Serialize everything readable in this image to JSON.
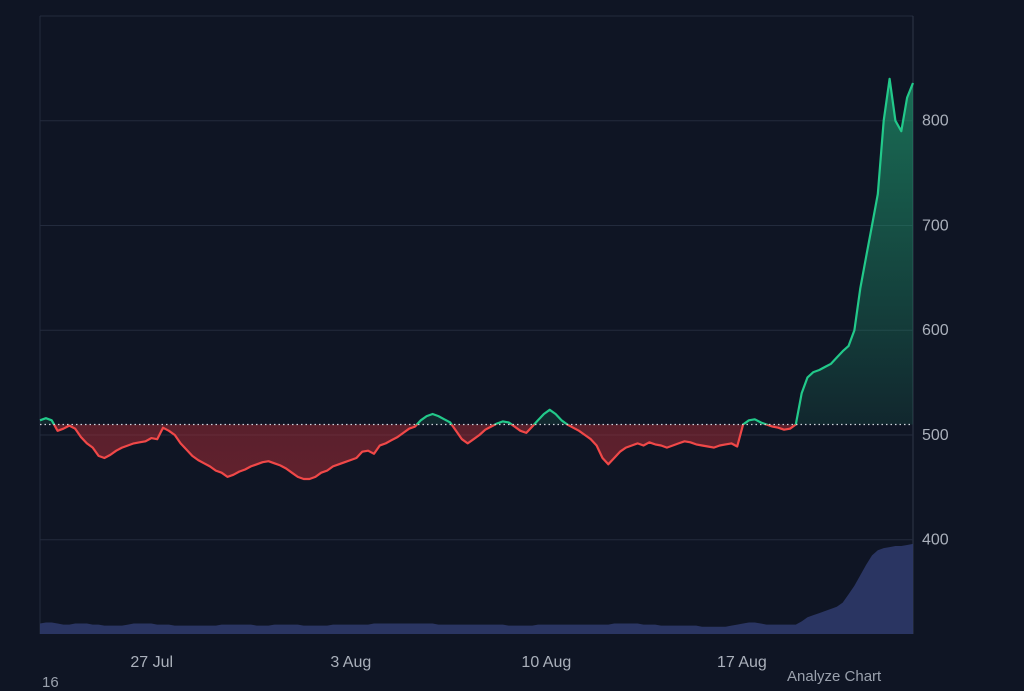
{
  "chart_data": {
    "type": "area",
    "title": "",
    "xlabel": "",
    "ylabel": "",
    "x_ticks": [
      "27 Jul",
      "3 Aug",
      "10 Aug",
      "17 Aug"
    ],
    "y_ticks": [
      400,
      500,
      600,
      700,
      800
    ],
    "ylim": [
      310,
      900
    ],
    "baseline": 510,
    "grid": true,
    "colors": {
      "above": "#22c98a",
      "below": "#f04848",
      "volume": "#2c3766",
      "grid": "#232b3d",
      "background": "#0f1524",
      "baseline": "#d0d4dc"
    },
    "series": [
      {
        "values": [
          514,
          516,
          514,
          504,
          506,
          509,
          506,
          498,
          492,
          488,
          480,
          478,
          481,
          485,
          488,
          490,
          492,
          493,
          494,
          497,
          496,
          507,
          504,
          500,
          492,
          486,
          480,
          476,
          473,
          470,
          466,
          464,
          460,
          462,
          465,
          467,
          470,
          472,
          474,
          475,
          473,
          471,
          468,
          464,
          460,
          458,
          458,
          460,
          464,
          466,
          470,
          472,
          474,
          476,
          478,
          484,
          485,
          482,
          490,
          492,
          495,
          498,
          502,
          506,
          508,
          514,
          518,
          520,
          518,
          515,
          512,
          504,
          496,
          492,
          496,
          500,
          505,
          508,
          511,
          513,
          512,
          508,
          504,
          502,
          508,
          514,
          520,
          524,
          520,
          514,
          510,
          507,
          504,
          500,
          496,
          490,
          478,
          472,
          478,
          484,
          488,
          490,
          492,
          490,
          493,
          491,
          490,
          488,
          490,
          492,
          494,
          493,
          491,
          490,
          489,
          488,
          490,
          491,
          492,
          489,
          510,
          514,
          515,
          512,
          510,
          508,
          507,
          505,
          506,
          510,
          540,
          555,
          560,
          562,
          565,
          568,
          574,
          580,
          585,
          600,
          640,
          670,
          700,
          730,
          800,
          840,
          800,
          790,
          822,
          836
        ],
        "volume": [
          320,
          321,
          321,
          320,
          319,
          319,
          320,
          320,
          320,
          319,
          319,
          318,
          318,
          318,
          318,
          319,
          320,
          320,
          320,
          320,
          319,
          319,
          319,
          318,
          318,
          318,
          318,
          318,
          318,
          318,
          318,
          319,
          319,
          319,
          319,
          319,
          319,
          318,
          318,
          318,
          319,
          319,
          319,
          319,
          319,
          318,
          318,
          318,
          318,
          318,
          319,
          319,
          319,
          319,
          319,
          319,
          319,
          320,
          320,
          320,
          320,
          320,
          320,
          320,
          320,
          320,
          320,
          320,
          319,
          319,
          319,
          319,
          319,
          319,
          319,
          319,
          319,
          319,
          319,
          319,
          318,
          318,
          318,
          318,
          318,
          319,
          319,
          319,
          319,
          319,
          319,
          319,
          319,
          319,
          319,
          319,
          319,
          319,
          320,
          320,
          320,
          320,
          320,
          319,
          319,
          319,
          318,
          318,
          318,
          318,
          318,
          318,
          318,
          317,
          317,
          317,
          317,
          317,
          318,
          319,
          320,
          321,
          321,
          320,
          319,
          319,
          319,
          319,
          319,
          319,
          322,
          326,
          328,
          330,
          332,
          334,
          336,
          340,
          348,
          356,
          366,
          376,
          385,
          390,
          392,
          393,
          394,
          394,
          395,
          396
        ]
      }
    ],
    "footer_left": "16",
    "footer_right": "Analyze Chart"
  }
}
